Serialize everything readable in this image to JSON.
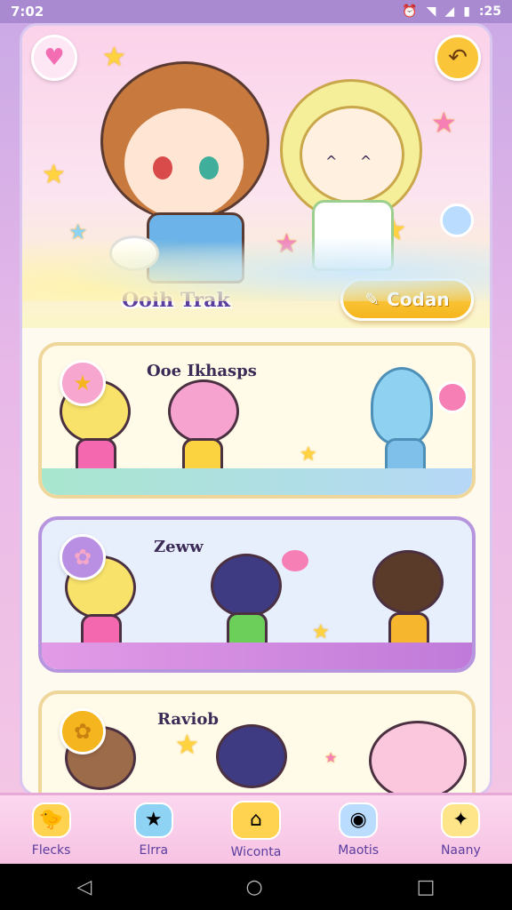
{
  "status_bar": {
    "time": "7:02",
    "right_text": ":25",
    "icons": [
      "alarm-icon",
      "wifi-icon",
      "signal-icon",
      "battery-icon"
    ]
  },
  "hero": {
    "title": "Ooih  Trak",
    "action_button_label": "Codan",
    "left_icon": "heart-icon",
    "right_icon": "back-icon"
  },
  "cards": [
    {
      "title": "Ooe Ikhasps",
      "badge_icon": "star-icon",
      "floor_color": "#a8e6ce"
    },
    {
      "title": "Zeww",
      "badge_icon": "flower-icon",
      "floor_color": "#e29be6"
    },
    {
      "title": "Raviob",
      "badge_icon": "flower-icon",
      "floor_color": "#fffbe8"
    }
  ],
  "tabbar": {
    "items": [
      {
        "label": "Flecks",
        "icon": "chick-icon",
        "active": false
      },
      {
        "label": "Elrra",
        "icon": "star-badge-icon",
        "active": false
      },
      {
        "label": "Wiconta",
        "icon": "home-icon",
        "active": true
      },
      {
        "label": "Maotis",
        "icon": "location-icon",
        "active": false
      },
      {
        "label": "Naany",
        "icon": "sparkle-icon",
        "active": false
      }
    ]
  },
  "colors": {
    "accent": "#ffd34f",
    "primary_text": "#5a3d9e",
    "frame_border": "#d9c7ef"
  }
}
